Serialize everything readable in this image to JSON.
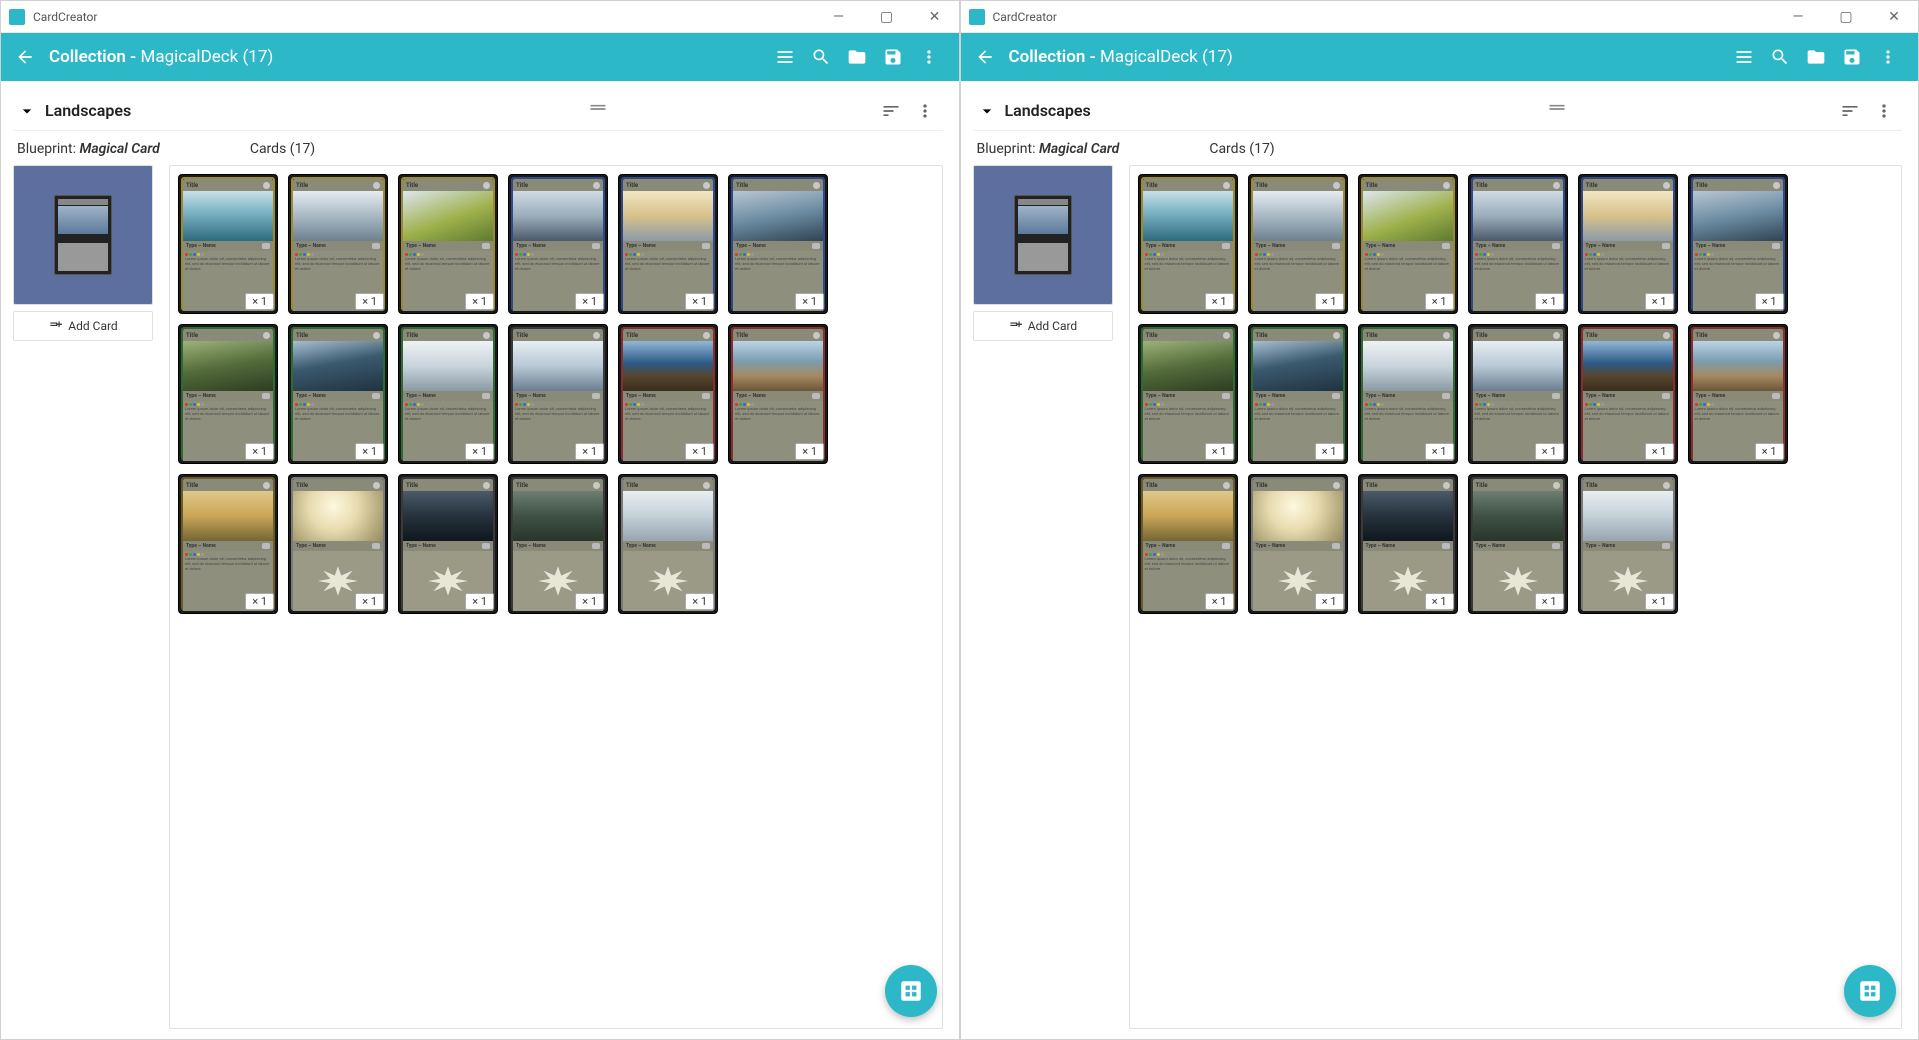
{
  "app": {
    "name": "CardCreator",
    "collection_prefix": "Collection -",
    "collection_name": "MagicalDeck",
    "collection_count": "(17)"
  },
  "window_controls": {
    "min": "—",
    "max": "▢",
    "close": "✕"
  },
  "toolbar_icons": [
    "list",
    "search",
    "folder",
    "save",
    "menu"
  ],
  "section": {
    "name": "Landscapes",
    "sort_icon": "sort",
    "menu_icon": "more"
  },
  "blueprint": {
    "label": "Blueprint:",
    "name": "Magical Card",
    "add_card": "Add Card"
  },
  "cards_label": "Cards",
  "cards_count": "(17)",
  "card_template": {
    "title": "Title",
    "type": "Type – Name",
    "lorem": "Lorem ipsum dolor sit, consectetur adipiscing elit, sed do eiusmod tempor incididunt ut labore et dolore"
  },
  "count_badge": "× 1",
  "cards": [
    {
      "frame": "#9a8b2e",
      "art": "art-ocean1",
      "body": "text"
    },
    {
      "frame": "#9a8b2e",
      "art": "art-misty",
      "body": "text"
    },
    {
      "frame": "#9a8b2e",
      "art": "art-hill",
      "body": "text"
    },
    {
      "frame": "#2e4a8a",
      "art": "art-snow",
      "body": "text"
    },
    {
      "frame": "#2e4a8a",
      "art": "art-sunset",
      "body": "text"
    },
    {
      "frame": "#2e4a8a",
      "art": "art-mountain",
      "body": "text"
    },
    {
      "frame": "#2d6b33",
      "art": "art-forest",
      "body": "text"
    },
    {
      "frame": "#2d6b33",
      "art": "art-coast",
      "body": "text"
    },
    {
      "frame": "#2d6b33",
      "art": "art-clouds",
      "body": "text"
    },
    {
      "frame": "#3a3a3a",
      "art": "art-snowmtn",
      "body": "text"
    },
    {
      "frame": "#8a2d2d",
      "art": "art-cliff",
      "body": "text"
    },
    {
      "frame": "#8a2d2d",
      "art": "art-beach",
      "body": "text"
    },
    {
      "frame": "#6b5a2a",
      "art": "art-golden",
      "body": "text"
    },
    {
      "frame": "#7a7a7a",
      "art": "art-light",
      "body": "sunburst"
    },
    {
      "frame": "#3a3a3a",
      "art": "art-darksea",
      "body": "sunburst"
    },
    {
      "frame": "#3a3a3a",
      "art": "art-pine",
      "body": "sunburst"
    },
    {
      "frame": "#7a7a7a",
      "art": "art-frost",
      "body": "sunburst"
    }
  ]
}
